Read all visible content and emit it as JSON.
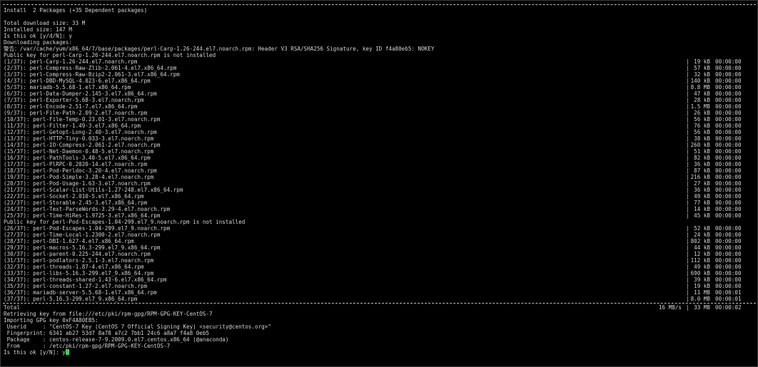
{
  "header": {
    "install_line": "Install  2 Packages (+35 Dependent packages)",
    "total_download": "Total download size: 33 M",
    "installed_size": "Installed size: 147 M",
    "confirm_prompt": "Is this ok [y/d/N]: y",
    "downloading": "Downloading packages:",
    "warning_line": "警告：/var/cache/yum/x86_64/7/base/packages/perl-Carp-1.26-244.el7.noarch.rpm: Header V3 RSA/SHA256 Signature, key ID f4a80eb5: NOKEY",
    "pubkey_line_1": "Public key for perl-Carp-1.26-244.el7.noarch.rpm is not installed"
  },
  "packages_part1": [
    {
      "name": "(1/37): perl-Carp-1.26-244.el7.noarch.rpm",
      "size": "19 kB",
      "time": "00:00:00"
    },
    {
      "name": "(2/37): perl-Compress-Raw-Zlib-2.061-4.el7.x86_64.rpm",
      "size": "57 kB",
      "time": "00:00:00"
    },
    {
      "name": "(3/37): perl-Compress-Raw-Bzip2-2.061-3.el7.x86_64.rpm",
      "size": "32 kB",
      "time": "00:00:00"
    },
    {
      "name": "(4/37): perl-DBD-MySQL-4.023-6.el7.x86_64.rpm",
      "size": "140 kB",
      "time": "00:00:00"
    },
    {
      "name": "(5/37): mariadb-5.5.68-1.el7.x86_64.rpm",
      "size": "8.8 MB",
      "time": "00:00:00"
    },
    {
      "name": "(6/37): perl-Data-Dumper-2.145-3.el7.x86_64.rpm",
      "size": "47 kB",
      "time": "00:00:00"
    },
    {
      "name": "(7/37): perl-Exporter-5.68-3.el7.noarch.rpm",
      "size": "28 kB",
      "time": "00:00:00"
    },
    {
      "name": "(8/37): perl-Encode-2.51-7.el7.x86_64.rpm",
      "size": "1.5 MB",
      "time": "00:00:00"
    },
    {
      "name": "(9/37): perl-File-Path-2.09-2.el7.noarch.rpm",
      "size": "26 kB",
      "time": "00:00:00"
    },
    {
      "name": "(10/37): perl-File-Temp-0.23.01-3.el7.noarch.rpm",
      "size": "56 kB",
      "time": "00:00:00"
    },
    {
      "name": "(11/37): perl-Filter-1.49-3.el7.x86_64.rpm",
      "size": "76 kB",
      "time": "00:00:00"
    },
    {
      "name": "(12/37): perl-Getopt-Long-2.40-3.el7.noarch.rpm",
      "size": "56 kB",
      "time": "00:00:00"
    },
    {
      "name": "(13/37): perl-HTTP-Tiny-0.033-3.el7.noarch.rpm",
      "size": "38 kB",
      "time": "00:00:00"
    },
    {
      "name": "(14/37): perl-IO-Compress-2.061-2.el7.noarch.rpm",
      "size": "260 kB",
      "time": "00:00:00"
    },
    {
      "name": "(15/37): perl-Net-Daemon-0.48-5.el7.noarch.rpm",
      "size": "51 kB",
      "time": "00:00:00"
    },
    {
      "name": "(16/37): perl-PathTools-3.40-5.el7.x86_64.rpm",
      "size": "82 kB",
      "time": "00:00:00"
    },
    {
      "name": "(17/37): perl-PlRPC-0.2020-14.el7.noarch.rpm",
      "size": "36 kB",
      "time": "00:00:00"
    },
    {
      "name": "(18/37): perl-Pod-Perldoc-3.20-4.el7.noarch.rpm",
      "size": "87 kB",
      "time": "00:00:00"
    },
    {
      "name": "(19/37): perl-Pod-Simple-3.28-4.el7.noarch.rpm",
      "size": "216 kB",
      "time": "00:00:00"
    },
    {
      "name": "(20/37): perl-Pod-Usage-1.63-3.el7.noarch.rpm",
      "size": "27 kB",
      "time": "00:00:00"
    },
    {
      "name": "(21/37): perl-Scalar-List-Utils-1.27-248.el7.x86_64.rpm",
      "size": "36 kB",
      "time": "00:00:00"
    },
    {
      "name": "(22/37): perl-Socket-2.010-5.el7.x86_64.rpm",
      "size": "49 kB",
      "time": "00:00:00"
    },
    {
      "name": "(23/37): perl-Storable-2.45-3.el7.x86_64.rpm",
      "size": "77 kB",
      "time": "00:00:00"
    },
    {
      "name": "(24/37): perl-Text-ParseWords-3.29-4.el7.noarch.rpm",
      "size": "14 kB",
      "time": "00:00:00"
    },
    {
      "name": "(25/37): perl-Time-HiRes-1.9725-3.el7.x86_64.rpm",
      "size": "45 kB",
      "time": "00:00:00"
    }
  ],
  "pubkey_line_2": "Public key for perl-Pod-Escapes-1.04-299.el7_9.noarch.rpm is not installed",
  "packages_part2": [
    {
      "name": "(26/37): perl-Pod-Escapes-1.04-299.el7_9.noarch.rpm",
      "size": "52 kB",
      "time": "00:00:00"
    },
    {
      "name": "(27/37): perl-Time-Local-1.2300-2.el7.noarch.rpm",
      "size": "24 kB",
      "time": "00:00:00"
    },
    {
      "name": "(28/37): perl-DBI-1.627-4.el7.x86_64.rpm",
      "size": "802 kB",
      "time": "00:00:00"
    },
    {
      "name": "(29/37): perl-macros-5.16.3-299.el7_9.x86_64.rpm",
      "size": "44 kB",
      "time": "00:00:00"
    },
    {
      "name": "(30/37): perl-parent-0.225-244.el7.noarch.rpm",
      "size": "12 kB",
      "time": "00:00:00"
    },
    {
      "name": "(31/37): perl-podlators-2.5.1-3.el7.noarch.rpm",
      "size": "112 kB",
      "time": "00:00:00"
    },
    {
      "name": "(32/37): perl-threads-1.87-4.el7.x86_64.rpm",
      "size": "49 kB",
      "time": "00:00:00"
    },
    {
      "name": "(33/37): perl-libs-5.16.3-299.el7_9.x86_64.rpm",
      "size": "690 kB",
      "time": "00:00:00"
    },
    {
      "name": "(34/37): perl-threads-shared-1.43-6.el7.x86_64.rpm",
      "size": "39 kB",
      "time": "00:00:00"
    },
    {
      "name": "(35/37): perl-constant-1.27-2.el7.noarch.rpm",
      "size": "19 kB",
      "time": "00:00:00"
    },
    {
      "name": "(36/37): mariadb-server-5.5.68-1.el7.x86_64.rpm",
      "size": "11 MB",
      "time": "00:00:01"
    },
    {
      "name": "(37/37): perl-5.16.3-299.el7_9.x86_64.rpm",
      "size": "8.0 MB",
      "time": "00:00:01"
    }
  ],
  "total": {
    "label": "Total",
    "speed": "16 MB/s",
    "size": "33 MB",
    "time": "00:00:02"
  },
  "footer": {
    "retrieving": "Retrieving key from file:///etc/pki/rpm-gpg/RPM-GPG-KEY-CentOS-7",
    "importing": "Importing GPG key 0xF4A80EB5:",
    "userid": " Userid     : \"CentOS-7 Key (CentOS 7 Official Signing Key) <security@centos.org>\"",
    "fingerprint": " Fingerprint: 6341 ab27 53d7 8a78 a7c2 7bb1 24c6 a8a7 f4a8 0eb5",
    "package": " Package    : centos-release-7-9.2009.0.el7.centos.x86_64 (@anaconda)",
    "from": " From       : /etc/pki/rpm-gpg/RPM-GPG-KEY-CentOS-7",
    "prompt": "Is this ok [y/N]: y"
  },
  "colors": {
    "background": "#000000",
    "text": "#d4d4d4",
    "cursor": "#39d353"
  }
}
